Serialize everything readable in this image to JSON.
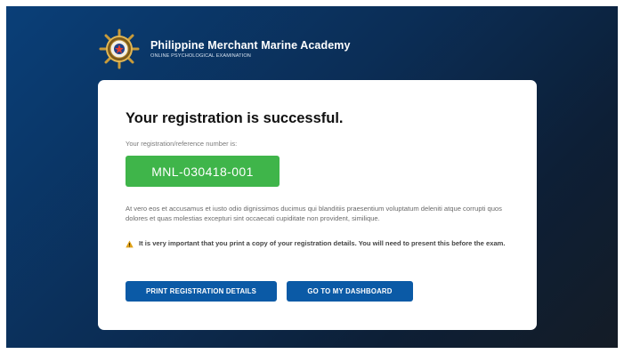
{
  "header": {
    "title": "Philippine Merchant Marine Academy",
    "subtitle": "ONLINE PSYCHOLOGICAL EXAMINATION",
    "logo_icon": "academy-seal-icon"
  },
  "card": {
    "title": "Your registration is successful.",
    "reference_label": "Your registration/reference number is:",
    "reference_number": "MNL-030418-001",
    "body_text": "At vero eos et accusamus et iusto odio dignissimos ducimus qui blanditiis praesentium voluptatum deleniti atque corrupti quos dolores et quas molestias excepturi sint occaecati cupiditate non provident, similique.",
    "warning_icon": "warning-icon",
    "warning_text": "It is very important that you print a copy of your registration details. You will need to present this before the exam.",
    "print_button": "PRINT REGISTRATION DETAILS",
    "dashboard_button": "GO TO MY DASHBOARD"
  },
  "colors": {
    "accent_green": "#3fb54a",
    "button_blue": "#0b5aa6",
    "background_dark": "#0b2d55",
    "warning": "#e0a21a"
  }
}
